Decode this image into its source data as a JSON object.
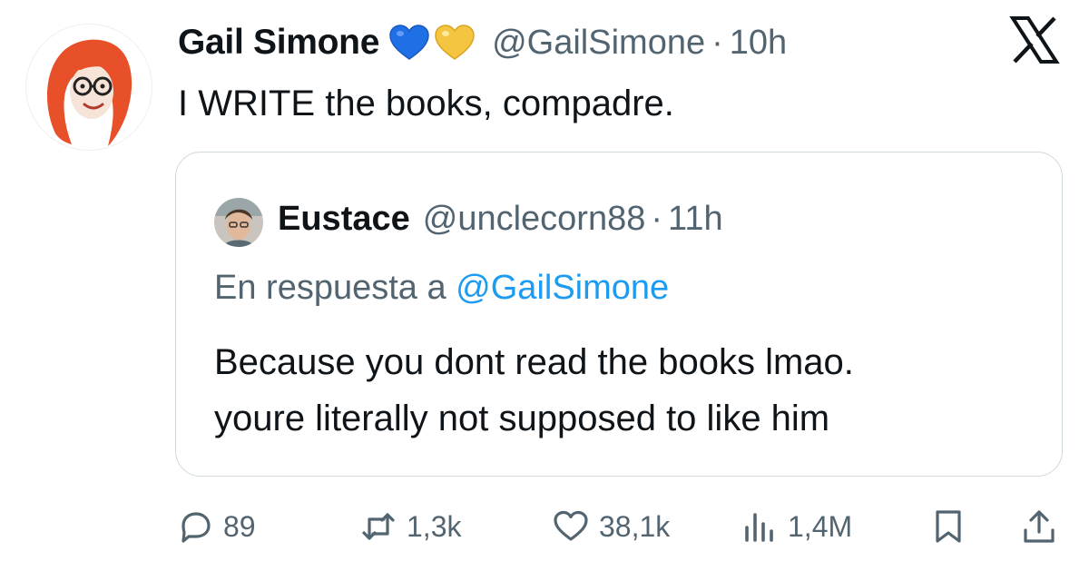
{
  "tweet": {
    "author": {
      "display_name": "Gail Simone",
      "handle": "@GailSimone",
      "time": "10h",
      "separator": "·",
      "badges": [
        {
          "icon": "blue-heart-icon",
          "color": "#1f6fe5"
        },
        {
          "icon": "yellow-heart-icon",
          "color": "#f5c542"
        }
      ]
    },
    "text": "I WRITE the books, compadre."
  },
  "quote": {
    "author": {
      "display_name": "Eustace",
      "handle": "@unclecorn88",
      "time": "11h",
      "separator": "·"
    },
    "reply_prefix": "En respuesta a",
    "reply_to": "@GailSimone",
    "text_lines": [
      "Because you dont read the books lmao.",
      "youre literally not supposed to like him"
    ]
  },
  "actions": {
    "replies": "89",
    "reposts": "1,3k",
    "likes": "38,1k",
    "views": "1,4M"
  },
  "colors": {
    "text": "#0f1419",
    "secondary": "#536471",
    "link": "#1d9bf0",
    "border": "#cfd9de"
  },
  "icons": {
    "app_logo": "x-logo-icon",
    "reply": "reply-bubble-icon",
    "repost": "repost-icon",
    "like": "heart-outline-icon",
    "views": "views-bar-icon",
    "bookmark": "bookmark-icon",
    "share": "share-icon"
  }
}
